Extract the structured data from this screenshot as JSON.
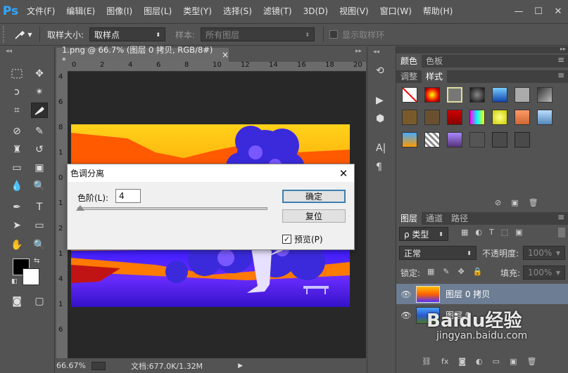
{
  "app": {
    "logo": "Ps",
    "accent": "#31a8ff"
  },
  "menu": [
    "文件(F)",
    "编辑(E)",
    "图像(I)",
    "图层(L)",
    "类型(Y)",
    "选择(S)",
    "滤镜(T)",
    "3D(D)",
    "视图(V)",
    "窗口(W)",
    "帮助(H)"
  ],
  "window_controls": {
    "minimize": "—",
    "maximize": "☐",
    "close": "✕"
  },
  "options": {
    "sample_size_label": "取样大小:",
    "sample_size_value": "取样点",
    "sample_label": "样本:",
    "sample_value": "所有图层",
    "show_ring_label": "显示取样环"
  },
  "document": {
    "tab_title": "1.png @ 66.7% (图层 0 拷贝, RGB/8#) *",
    "close": "×",
    "ruler_top": [
      "0",
      "2",
      "4",
      "6",
      "8",
      "10",
      "12",
      "14",
      "16",
      "18",
      "20"
    ],
    "ruler_left": [
      "4",
      "6",
      "8",
      "1",
      "0",
      "1",
      "2",
      "1",
      "4",
      "1",
      "6"
    ],
    "zoom": "66.67%",
    "doc_info": "文档:677.0K/1.32M"
  },
  "panels": {
    "tabs_top": [
      "颜色",
      "色板"
    ],
    "tabs_mid": [
      "调整",
      "样式"
    ],
    "tabs_layers": [
      "图层",
      "通道",
      "路径"
    ],
    "filter_kind": "ρ 类型",
    "blend_mode": "正常",
    "opacity_label": "不透明度:",
    "opacity_value": "100%",
    "lock_label": "锁定:",
    "fill_label": "填充:",
    "fill_value": "100%",
    "layers": [
      {
        "name": "图层 0 拷贝",
        "selected": true
      },
      {
        "name": "图层 0",
        "selected": false
      }
    ]
  },
  "dialog": {
    "title": "色调分离",
    "levels_label": "色阶(L):",
    "levels_value": "4",
    "ok_label": "确定",
    "reset_label": "复位",
    "preview_label": "预览(P)",
    "preview_checked": true
  },
  "watermark": {
    "text": "Baidu经验",
    "url": "jingyan.baidu.com"
  }
}
